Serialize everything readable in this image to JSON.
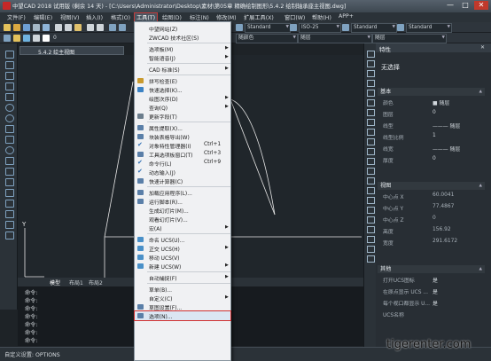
{
  "window": {
    "title": "中望CAD 2018 试用版 (剩余 14 天) - [C:\\Users\\Administrator\\Desktop\\素材\\第05章 精确绘制图形\\5.4.2 绘制轴承座主视图.dwg]",
    "min_label": "—",
    "max_label": "□",
    "close_label": "✕"
  },
  "menubar": [
    "文件(F)",
    "编辑(E)",
    "视图(V)",
    "插入(I)",
    "格式(O)",
    "工具(T)",
    "绘图(D)",
    "标注(N)",
    "修改(M)",
    "扩展工具(X)",
    "窗口(W)",
    "帮助(H)",
    "APP+"
  ],
  "toolbar": {
    "layer_value": "0",
    "textstyle": "Standard",
    "dimstyle": "ISO-25",
    "tablestyle": "Standard",
    "mleaderstyle": "Standard",
    "linetype": "随层",
    "lineweight": "随层",
    "color": "随颜色"
  },
  "doc_tab": "5.4.2 绘主视图",
  "layout_tabs": [
    "模型",
    "布局1",
    "布局2"
  ],
  "command_lines": [
    "命令:",
    "命令:",
    "命令:",
    "命令:",
    "命令:",
    "命令:"
  ],
  "command_prompt": "命令:",
  "status_text": "自定义设置: OPTIONS",
  "properties": {
    "title": "特性",
    "selection": "无选择",
    "sections": {
      "basic": "基本",
      "view": "视图",
      "misc": "其他"
    },
    "basic_rows": [
      {
        "label": "颜色",
        "value": "■ 随层"
      },
      {
        "label": "图层",
        "value": "0"
      },
      {
        "label": "线型",
        "value": "——— 随层"
      },
      {
        "label": "线型比例",
        "value": "1"
      },
      {
        "label": "线宽",
        "value": "——— 随层"
      },
      {
        "label": "厚度",
        "value": "0"
      }
    ],
    "view_rows": [
      {
        "label": "中心点 X",
        "value": "60.0041"
      },
      {
        "label": "中心点 Y",
        "value": "77.4867"
      },
      {
        "label": "中心点 Z",
        "value": "0"
      },
      {
        "label": "高度",
        "value": "156.92"
      },
      {
        "label": "宽度",
        "value": "291.6172"
      }
    ],
    "misc_rows": [
      {
        "label": "打开UCS图标",
        "value": "是"
      },
      {
        "label": "在原点显示 UCS ...",
        "value": "是"
      },
      {
        "label": "每个视口都显示 U...",
        "value": "是"
      },
      {
        "label": "UCS名称",
        "value": ""
      }
    ]
  },
  "tools_menu": {
    "items": [
      {
        "label": "中望网站(Z)",
        "shortcut": "",
        "arrow": false,
        "icon": "none"
      },
      {
        "label": "ZWCAD 技术社区(S)",
        "shortcut": "",
        "arrow": false,
        "icon": "none"
      },
      {
        "sep": true
      },
      {
        "label": "选项板(M)",
        "shortcut": "",
        "arrow": true,
        "icon": "none"
      },
      {
        "label": "智能语音(J)",
        "shortcut": "",
        "arrow": true,
        "icon": "none"
      },
      {
        "sep": true
      },
      {
        "label": "CAD 标准(S)",
        "shortcut": "",
        "arrow": true,
        "icon": "none"
      },
      {
        "sep": true
      },
      {
        "label": "拼写检查(E)",
        "shortcut": "",
        "arrow": false,
        "icon": "spell-icon"
      },
      {
        "label": "快速选择(K)...",
        "shortcut": "",
        "arrow": false,
        "icon": "quickselect-icon"
      },
      {
        "label": "绘图次序(D)",
        "shortcut": "",
        "arrow": true,
        "icon": "none"
      },
      {
        "label": "查询(Q)",
        "shortcut": "",
        "arrow": true,
        "icon": "none"
      },
      {
        "label": "更新字段(T)",
        "shortcut": "",
        "arrow": false,
        "icon": "update-field-icon"
      },
      {
        "sep": true
      },
      {
        "label": "属性提取(X)...",
        "shortcut": "",
        "arrow": false,
        "icon": "attribute-extract-icon"
      },
      {
        "label": "块装表格导出(W)",
        "shortcut": "",
        "arrow": false,
        "icon": "block-table-icon"
      },
      {
        "label": "对象特性管理器(I)",
        "shortcut": "Ctrl+1",
        "arrow": false,
        "icon": "check-icon"
      },
      {
        "label": "工具选项板窗口(T)",
        "shortcut": "Ctrl+3",
        "arrow": false,
        "icon": "palette-icon"
      },
      {
        "label": "命令行(L)",
        "shortcut": "Ctrl+9",
        "arrow": false,
        "icon": "check-icon"
      },
      {
        "label": "动态输入(J)",
        "shortcut": "",
        "arrow": false,
        "icon": "check-icon"
      },
      {
        "label": "快速计算器(C)",
        "shortcut": "",
        "arrow": false,
        "icon": "calculator-icon"
      },
      {
        "sep": true
      },
      {
        "label": "加载应用程序(L)...",
        "shortcut": "",
        "arrow": false,
        "icon": "load-app-icon"
      },
      {
        "label": "运行脚本(R)...",
        "shortcut": "",
        "arrow": false,
        "icon": "script-icon"
      },
      {
        "label": "生成幻灯片(M)...",
        "shortcut": "",
        "arrow": false,
        "icon": "none"
      },
      {
        "label": "观看幻灯片(V)...",
        "shortcut": "",
        "arrow": false,
        "icon": "none"
      },
      {
        "label": "宏(A)",
        "shortcut": "",
        "arrow": true,
        "icon": "none"
      },
      {
        "sep": true
      },
      {
        "label": "命名 UCS(U)...",
        "shortcut": "",
        "arrow": false,
        "icon": "ucs-icon"
      },
      {
        "label": "正交 UCS(H)",
        "shortcut": "",
        "arrow": true,
        "icon": "ucs-icon"
      },
      {
        "label": "移动 UCS(V)",
        "shortcut": "",
        "arrow": false,
        "icon": "ucs-icon"
      },
      {
        "label": "新建 UCS(W)",
        "shortcut": "",
        "arrow": true,
        "icon": "ucs-icon"
      },
      {
        "sep": true
      },
      {
        "label": "自动捕捉(F)",
        "shortcut": "",
        "arrow": true,
        "icon": "none"
      },
      {
        "sep": true
      },
      {
        "label": "草单(B)...",
        "shortcut": "",
        "arrow": false,
        "icon": "none"
      },
      {
        "label": "自定义(C)",
        "shortcut": "",
        "arrow": true,
        "icon": "none"
      },
      {
        "label": "草图设置(F)...",
        "shortcut": "",
        "arrow": false,
        "icon": "drafting-icon"
      },
      {
        "label": "选项(N)...",
        "shortcut": "",
        "arrow": false,
        "icon": "options-icon",
        "highlight": true
      }
    ]
  },
  "watermark": "tigerenter.com"
}
